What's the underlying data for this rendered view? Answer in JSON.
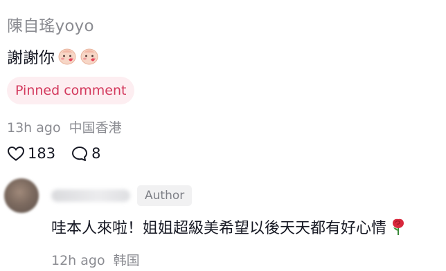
{
  "comment": {
    "username": "陳自瑤yoyo",
    "text": "謝謝你",
    "emojis": [
      "blush-face-emoji",
      "blush-face-emoji"
    ],
    "pinned_label": "Pinned comment",
    "time": "13h ago",
    "region": "中国香港",
    "likes": "183",
    "replies": "8"
  },
  "reply": {
    "author_badge": "Author",
    "text": "哇本人來啦！姐姐超級美希望以後天天都有好心情",
    "emoji": "rose-emoji",
    "time": "12h ago",
    "region": "韩国"
  },
  "colors": {
    "secondary_text": "#8a8b91",
    "pinned_text": "#d3385c",
    "pinned_bg": "#fdeef1",
    "badge_bg": "#f1f1f2"
  }
}
